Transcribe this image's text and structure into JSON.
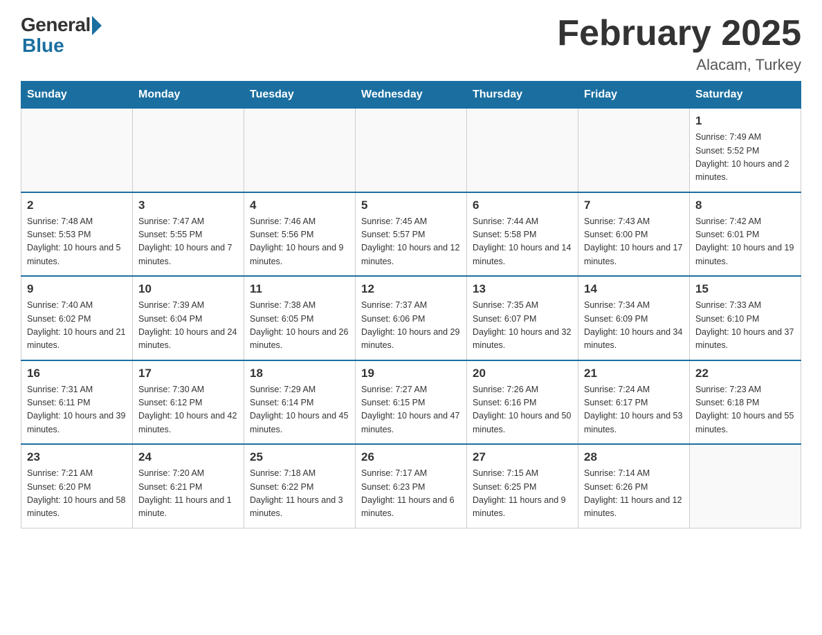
{
  "logo": {
    "general": "General",
    "blue": "Blue"
  },
  "header": {
    "month": "February 2025",
    "location": "Alacam, Turkey"
  },
  "days_of_week": [
    "Sunday",
    "Monday",
    "Tuesday",
    "Wednesday",
    "Thursday",
    "Friday",
    "Saturday"
  ],
  "weeks": [
    [
      {
        "day": "",
        "info": ""
      },
      {
        "day": "",
        "info": ""
      },
      {
        "day": "",
        "info": ""
      },
      {
        "day": "",
        "info": ""
      },
      {
        "day": "",
        "info": ""
      },
      {
        "day": "",
        "info": ""
      },
      {
        "day": "1",
        "info": "Sunrise: 7:49 AM\nSunset: 5:52 PM\nDaylight: 10 hours and 2 minutes."
      }
    ],
    [
      {
        "day": "2",
        "info": "Sunrise: 7:48 AM\nSunset: 5:53 PM\nDaylight: 10 hours and 5 minutes."
      },
      {
        "day": "3",
        "info": "Sunrise: 7:47 AM\nSunset: 5:55 PM\nDaylight: 10 hours and 7 minutes."
      },
      {
        "day": "4",
        "info": "Sunrise: 7:46 AM\nSunset: 5:56 PM\nDaylight: 10 hours and 9 minutes."
      },
      {
        "day": "5",
        "info": "Sunrise: 7:45 AM\nSunset: 5:57 PM\nDaylight: 10 hours and 12 minutes."
      },
      {
        "day": "6",
        "info": "Sunrise: 7:44 AM\nSunset: 5:58 PM\nDaylight: 10 hours and 14 minutes."
      },
      {
        "day": "7",
        "info": "Sunrise: 7:43 AM\nSunset: 6:00 PM\nDaylight: 10 hours and 17 minutes."
      },
      {
        "day": "8",
        "info": "Sunrise: 7:42 AM\nSunset: 6:01 PM\nDaylight: 10 hours and 19 minutes."
      }
    ],
    [
      {
        "day": "9",
        "info": "Sunrise: 7:40 AM\nSunset: 6:02 PM\nDaylight: 10 hours and 21 minutes."
      },
      {
        "day": "10",
        "info": "Sunrise: 7:39 AM\nSunset: 6:04 PM\nDaylight: 10 hours and 24 minutes."
      },
      {
        "day": "11",
        "info": "Sunrise: 7:38 AM\nSunset: 6:05 PM\nDaylight: 10 hours and 26 minutes."
      },
      {
        "day": "12",
        "info": "Sunrise: 7:37 AM\nSunset: 6:06 PM\nDaylight: 10 hours and 29 minutes."
      },
      {
        "day": "13",
        "info": "Sunrise: 7:35 AM\nSunset: 6:07 PM\nDaylight: 10 hours and 32 minutes."
      },
      {
        "day": "14",
        "info": "Sunrise: 7:34 AM\nSunset: 6:09 PM\nDaylight: 10 hours and 34 minutes."
      },
      {
        "day": "15",
        "info": "Sunrise: 7:33 AM\nSunset: 6:10 PM\nDaylight: 10 hours and 37 minutes."
      }
    ],
    [
      {
        "day": "16",
        "info": "Sunrise: 7:31 AM\nSunset: 6:11 PM\nDaylight: 10 hours and 39 minutes."
      },
      {
        "day": "17",
        "info": "Sunrise: 7:30 AM\nSunset: 6:12 PM\nDaylight: 10 hours and 42 minutes."
      },
      {
        "day": "18",
        "info": "Sunrise: 7:29 AM\nSunset: 6:14 PM\nDaylight: 10 hours and 45 minutes."
      },
      {
        "day": "19",
        "info": "Sunrise: 7:27 AM\nSunset: 6:15 PM\nDaylight: 10 hours and 47 minutes."
      },
      {
        "day": "20",
        "info": "Sunrise: 7:26 AM\nSunset: 6:16 PM\nDaylight: 10 hours and 50 minutes."
      },
      {
        "day": "21",
        "info": "Sunrise: 7:24 AM\nSunset: 6:17 PM\nDaylight: 10 hours and 53 minutes."
      },
      {
        "day": "22",
        "info": "Sunrise: 7:23 AM\nSunset: 6:18 PM\nDaylight: 10 hours and 55 minutes."
      }
    ],
    [
      {
        "day": "23",
        "info": "Sunrise: 7:21 AM\nSunset: 6:20 PM\nDaylight: 10 hours and 58 minutes."
      },
      {
        "day": "24",
        "info": "Sunrise: 7:20 AM\nSunset: 6:21 PM\nDaylight: 11 hours and 1 minute."
      },
      {
        "day": "25",
        "info": "Sunrise: 7:18 AM\nSunset: 6:22 PM\nDaylight: 11 hours and 3 minutes."
      },
      {
        "day": "26",
        "info": "Sunrise: 7:17 AM\nSunset: 6:23 PM\nDaylight: 11 hours and 6 minutes."
      },
      {
        "day": "27",
        "info": "Sunrise: 7:15 AM\nSunset: 6:25 PM\nDaylight: 11 hours and 9 minutes."
      },
      {
        "day": "28",
        "info": "Sunrise: 7:14 AM\nSunset: 6:26 PM\nDaylight: 11 hours and 12 minutes."
      },
      {
        "day": "",
        "info": ""
      }
    ]
  ]
}
